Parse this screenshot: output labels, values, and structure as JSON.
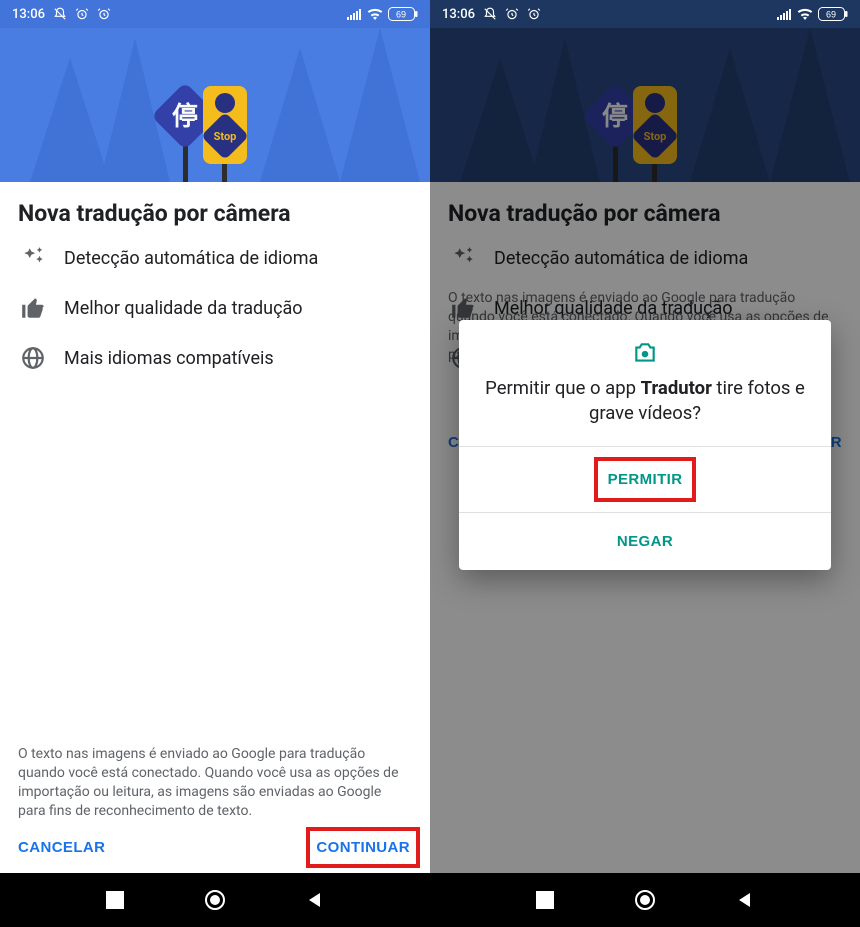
{
  "status": {
    "time": "13:06",
    "battery": "69"
  },
  "screen": {
    "title": "Nova tradução por câmera",
    "features": [
      "Detecção automática de idioma",
      "Melhor qualidade da tradução",
      "Mais idiomas compatíveis"
    ],
    "disclaimer": "O texto nas imagens é enviado ao Google para tradução quando você está conectado. Quando você usa as opções de importação ou leitura, as imagens são enviadas ao Google para fins de reconhecimento de texto.",
    "cancel": "CANCELAR",
    "continue": "CONTINUAR",
    "hero_sign_cn": "停",
    "hero_sign_en": "Stop"
  },
  "dialog": {
    "msg_prefix": "Permitir que o app ",
    "msg_app": "Tradutor",
    "msg_suffix": " tire fotos e grave vídeos?",
    "allow": "PERMITIR",
    "deny": "NEGAR"
  }
}
